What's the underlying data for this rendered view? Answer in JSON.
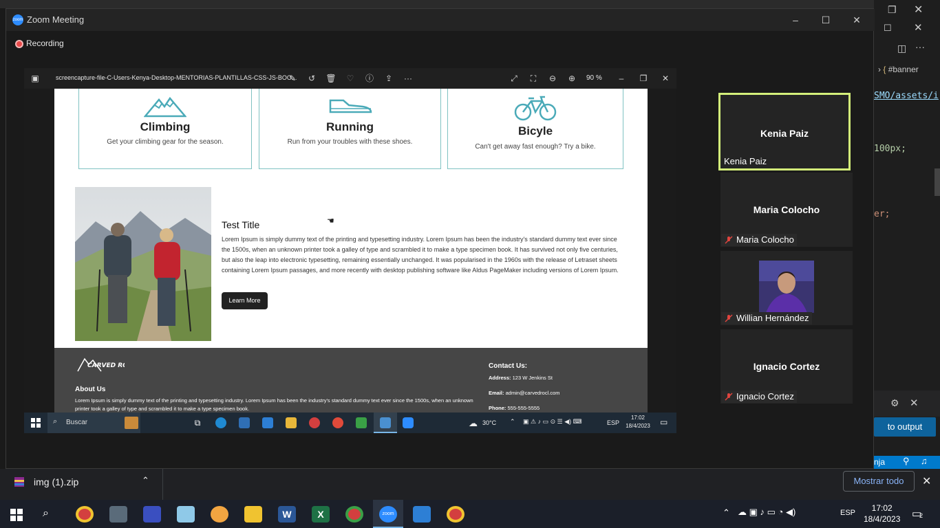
{
  "window": {
    "title": "Zoom Meeting",
    "recording_label": "Recording"
  },
  "viewer": {
    "file_name": "screencapture-file-C-Users-Kenya-Desktop-MENTORIAS-PLANTILLAS-CSS-JS-BOO...",
    "zoom_level": "90 %"
  },
  "webpage": {
    "cards": [
      {
        "title": "Climbing",
        "text": "Get your climbing gear for the season.",
        "icon": "mountain-icon"
      },
      {
        "title": "Running",
        "text": "Run from your troubles with these shoes.",
        "icon": "shoe-icon"
      },
      {
        "title": "Bicyle",
        "text": "Can't get away fast enough? Try a bike.",
        "icon": "bicycle-icon"
      }
    ],
    "article": {
      "title": "Test Title",
      "body": "Lorem Ipsum is simply dummy text of the printing and typesetting industry. Lorem Ipsum has been the industry's standard dummy text ever since the 1500s, when an unknown printer took a galley of type and scrambled it to make a type specimen book. It has survived not only five centuries, but also the leap into electronic typesetting, remaining essentially unchanged. It was popularised in the 1960s with the release of Letraset sheets containing Lorem Ipsum passages, and more recently with desktop publishing software like Aldus PageMaker including versions of Lorem Ipsum.",
      "button": "Learn More"
    },
    "footer": {
      "logo_text": "CARVED ROCK",
      "about_heading": "About Us",
      "about_text": "Lorem Ipsum is simply dummy text of the printing and typesetting industry. Lorem Ipsum has been the industry's standard dummy text ever since the 1500s, when an unknown printer took a galley of type and scrambled it to make a type specimen book.",
      "contact_heading": "Contact Us:",
      "address_label": "Address:",
      "address": "123 W Jenkins St",
      "email_label": "Email:",
      "email": "admin@carvedrocl.com",
      "phone_label": "Phone:",
      "phone": "555-555-5555"
    }
  },
  "inner_taskbar": {
    "search_placeholder": "Buscar",
    "temperature": "30°C",
    "lang": "ESP",
    "time": "17:02",
    "date": "18/4/2023"
  },
  "participants": [
    {
      "name": "Kenia Paiz",
      "label": "Kenia Paiz",
      "muted": false,
      "active": true
    },
    {
      "name": "Maria Colocho",
      "label": "Maria Colocho",
      "muted": true
    },
    {
      "name": "",
      "label": "Willian Hernández",
      "muted": true,
      "video": true
    },
    {
      "name": "Ignacio Cortez",
      "label": "Ignacio Cortez",
      "muted": true
    }
  ],
  "bg_editor": {
    "breadcrumb": "#banner",
    "lines": [
      "SMO/assets/i",
      "100px;",
      "er;"
    ],
    "output_button": "to output",
    "status_text": "nja"
  },
  "download_bar": {
    "file_name": "img (1).zip",
    "show_all": "Mostrar todo"
  },
  "taskbar": {
    "lang": "ESP",
    "time": "17:02",
    "date": "18/4/2023",
    "notification_count": "2"
  },
  "colors": {
    "zoom_blue": "#2d8cff",
    "active_speaker": "#d4f07a",
    "card_border": "#7fc2c2",
    "chrome_link": "#8ab4f8"
  }
}
